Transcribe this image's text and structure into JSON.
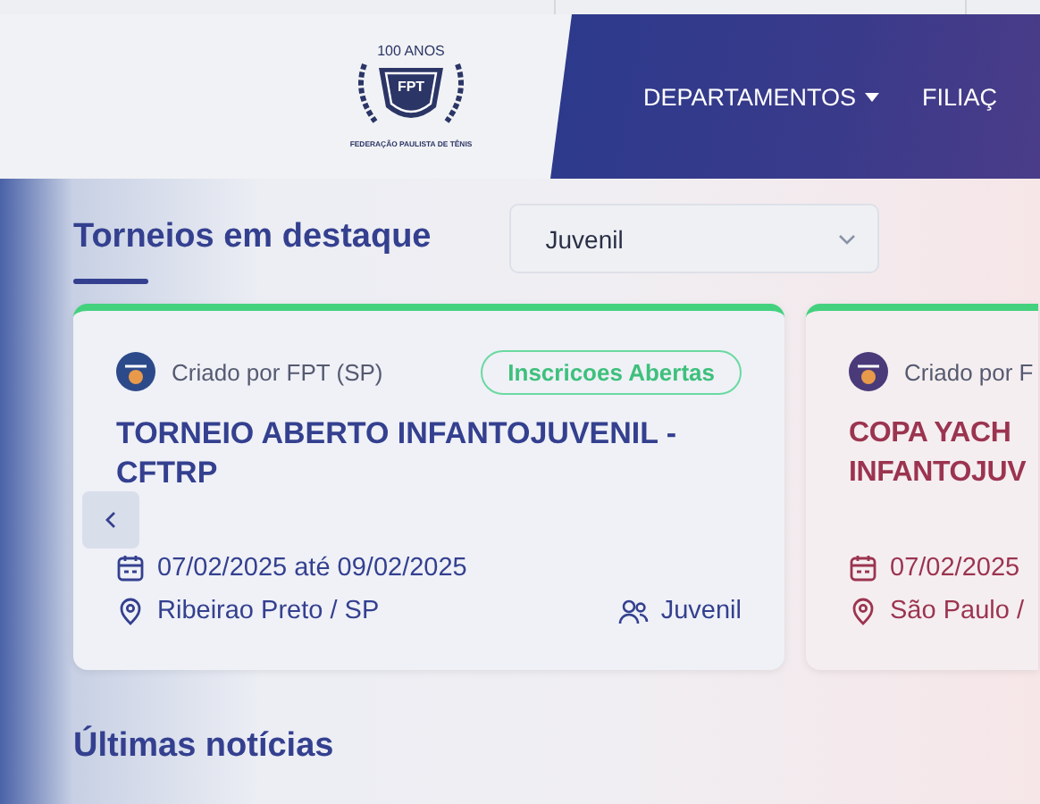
{
  "logo": {
    "top_text": "100 ANOS",
    "mark_text": "FPT",
    "caption": "FEDERAÇÃO PAULISTA DE TÊNIS"
  },
  "nav": [
    {
      "label": "DEPARTAMENTOS",
      "dropdown": true
    },
    {
      "label": "FILIAÇ",
      "dropdown": false
    }
  ],
  "featured": {
    "title": "Torneios em destaque",
    "filter": {
      "value": "Juvenil"
    }
  },
  "cards": [
    {
      "creator": "Criado por FPT (SP)",
      "status": "Inscricoes Abertas",
      "title": "TORNEIO ABERTO INFANTOJUVENIL - CFTRP",
      "dates": "07/02/2025 até 09/02/2025",
      "location": "Ribeirao Preto / SP",
      "category": "Juvenil",
      "color": "#34408f"
    },
    {
      "creator": "Criado por F",
      "title": "COPA YACH INFANTOJUV",
      "dates": "07/02/2025",
      "location": "São Paulo /",
      "color": "#9b3450"
    }
  ],
  "news": {
    "title": "Últimas notícias"
  }
}
